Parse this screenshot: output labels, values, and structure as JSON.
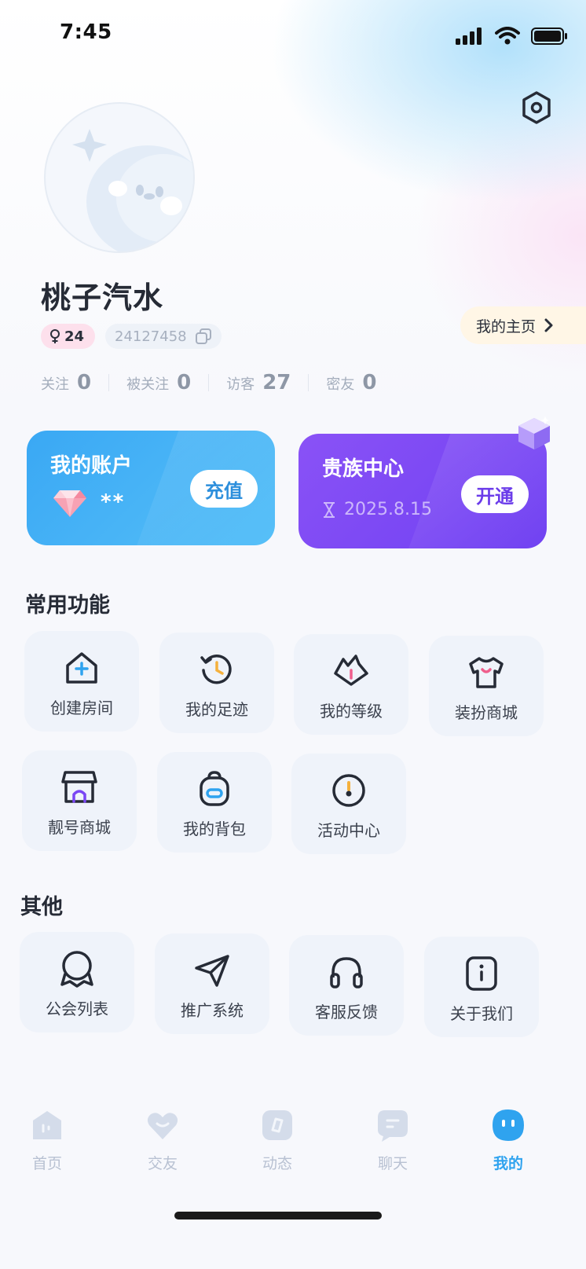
{
  "status_bar": {
    "time": "7:45"
  },
  "profile": {
    "username": "桃子汽水",
    "gender_age": "24",
    "user_id": "24127458",
    "homepage_label": "我的主页"
  },
  "stats": [
    {
      "label": "关注",
      "value": "0"
    },
    {
      "label": "被关注",
      "value": "0"
    },
    {
      "label": "访客",
      "value": "27"
    },
    {
      "label": "密友",
      "value": "0"
    }
  ],
  "account_card": {
    "title": "我的账户",
    "balance": "**",
    "action": "充值",
    "color": "#3aa8f4"
  },
  "noble_card": {
    "title": "贵族中心",
    "expiry": "2025.8.15",
    "action": "开通",
    "color": "#7a46f4"
  },
  "common_functions": {
    "title": "常用功能",
    "items": [
      {
        "label": "创建房间",
        "icon": "house-plus-icon"
      },
      {
        "label": "我的足迹",
        "icon": "history-clock-icon"
      },
      {
        "label": "我的等级",
        "icon": "level-badge-icon"
      },
      {
        "label": "装扮商城",
        "icon": "tshirt-icon"
      },
      {
        "label": "靓号商城",
        "icon": "shop-icon"
      },
      {
        "label": "我的背包",
        "icon": "backpack-icon"
      },
      {
        "label": "活动中心",
        "icon": "compass-icon"
      }
    ]
  },
  "other": {
    "title": "其他",
    "items": [
      {
        "label": "公会列表",
        "icon": "guild-icon"
      },
      {
        "label": "推广系统",
        "icon": "paper-plane-icon"
      },
      {
        "label": "客服反馈",
        "icon": "headphones-icon"
      },
      {
        "label": "关于我们",
        "icon": "info-icon"
      }
    ]
  },
  "tab_bar": {
    "active": "我的",
    "items": [
      {
        "label": "首页"
      },
      {
        "label": "交友"
      },
      {
        "label": "动态"
      },
      {
        "label": "聊天"
      },
      {
        "label": "我的"
      }
    ],
    "active_color": "#2fa3ef"
  }
}
